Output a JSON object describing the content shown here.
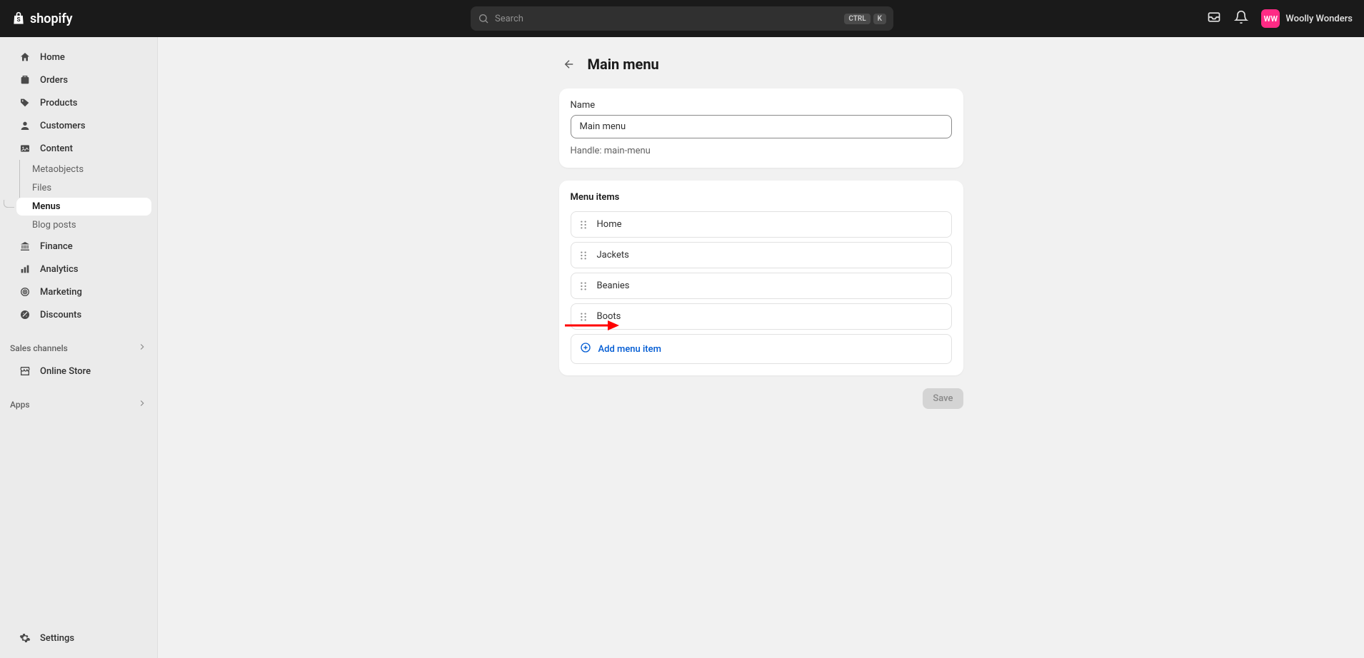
{
  "brand": "shopify",
  "search": {
    "placeholder": "Search",
    "kbd1": "CTRL",
    "kbd2": "K"
  },
  "store": {
    "initials": "WW",
    "name": "Woolly Wonders"
  },
  "sidebar": {
    "items": [
      {
        "label": "Home"
      },
      {
        "label": "Orders"
      },
      {
        "label": "Products"
      },
      {
        "label": "Customers"
      },
      {
        "label": "Content"
      },
      {
        "label": "Finance"
      },
      {
        "label": "Analytics"
      },
      {
        "label": "Marketing"
      },
      {
        "label": "Discounts"
      }
    ],
    "content_sub": [
      {
        "label": "Metaobjects"
      },
      {
        "label": "Files"
      },
      {
        "label": "Menus"
      },
      {
        "label": "Blog posts"
      }
    ],
    "sales_channels_label": "Sales channels",
    "online_store_label": "Online Store",
    "apps_label": "Apps",
    "settings_label": "Settings"
  },
  "page": {
    "title": "Main menu",
    "name_label": "Name",
    "name_value": "Main menu",
    "handle_text": "Handle: main-menu",
    "menu_items_title": "Menu items",
    "menu_items": [
      {
        "label": "Home"
      },
      {
        "label": "Jackets"
      },
      {
        "label": "Beanies"
      },
      {
        "label": "Boots"
      }
    ],
    "add_item_label": "Add menu item",
    "save_label": "Save"
  }
}
